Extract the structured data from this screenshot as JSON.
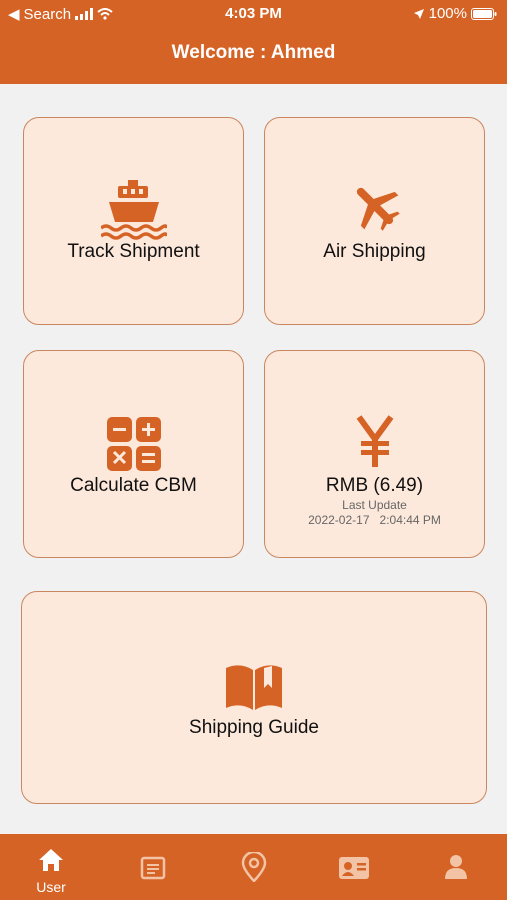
{
  "status": {
    "carrier": "Search",
    "time": "4:03 PM",
    "battery": "100%"
  },
  "header": {
    "welcome": "Welcome : Ahmed"
  },
  "cards": {
    "track": {
      "label": "Track Shipment",
      "icon": "ship-icon"
    },
    "air": {
      "label": "Air Shipping",
      "icon": "airplane-icon"
    },
    "cbm": {
      "label": "Calculate CBM",
      "icon": "calculator-icon"
    },
    "rmb": {
      "label": "RMB (6.49)",
      "icon": "yen-icon",
      "last_update_label": "Last Update",
      "date": "2022-02-17",
      "time": "2:04:44 PM"
    },
    "guide": {
      "label": "Shipping Guide",
      "icon": "book-icon"
    }
  },
  "tabs": [
    {
      "label": "User",
      "icon": "home-icon"
    },
    {
      "label": "",
      "icon": "orders-icon"
    },
    {
      "label": "",
      "icon": "location-icon"
    },
    {
      "label": "",
      "icon": "contact-card-icon"
    },
    {
      "label": "",
      "icon": "profile-icon"
    }
  ],
  "colors": {
    "accent": "#d66326",
    "card_bg": "#fde9dc",
    "card_border": "#c9875f",
    "bg": "#f1f1f1"
  }
}
